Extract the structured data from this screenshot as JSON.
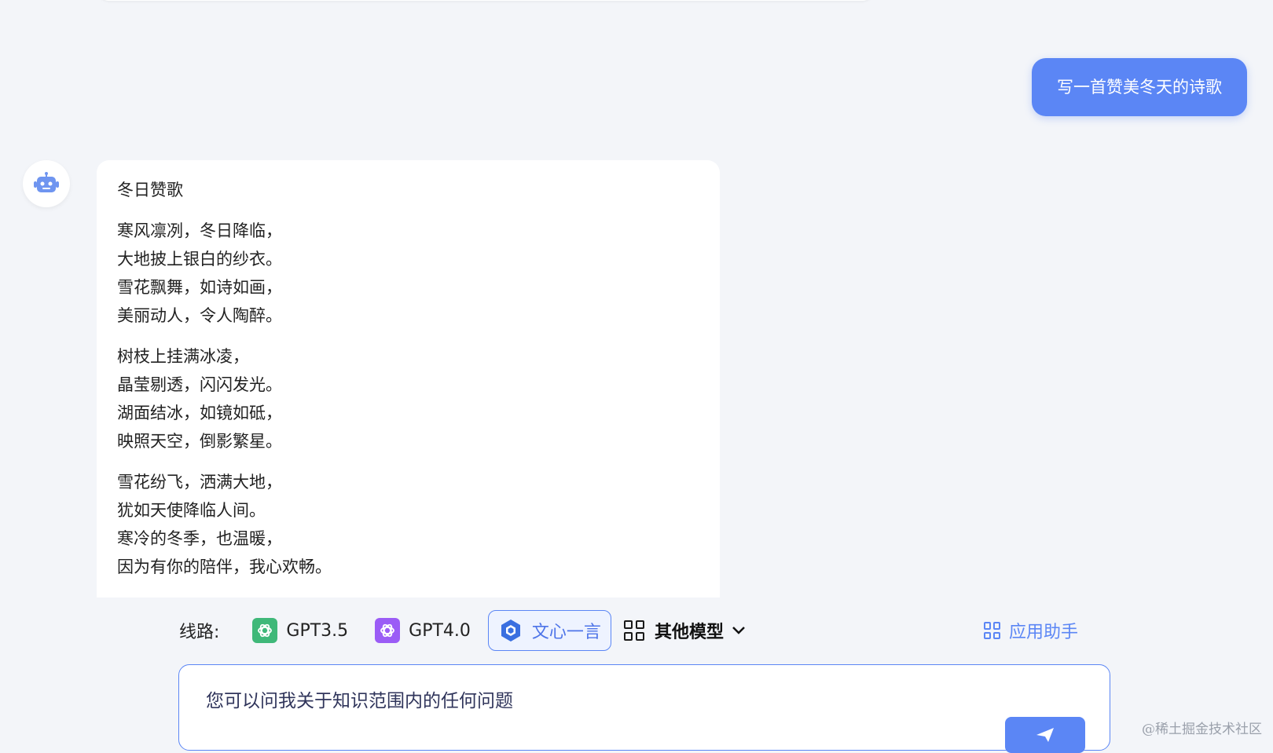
{
  "conversation": {
    "user_message": "写一首赞美冬天的诗歌",
    "bot_reply": {
      "title": "冬日赞歌",
      "stanzas": [
        [
          "寒风凛冽，冬日降临，",
          "大地披上银白的纱衣。",
          "雪花飘舞，如诗如画，",
          "美丽动人，令人陶醉。"
        ],
        [
          "树枝上挂满冰凌，",
          "晶莹剔透，闪闪发光。",
          "湖面结冰，如镜如砥，",
          "映照天空，倒影繁星。"
        ],
        [
          "雪花纷飞，洒满大地，",
          "犹如天使降临人间。",
          "寒冷的冬季，也温暖，",
          "因为有你的陪伴，我心欢畅。"
        ]
      ]
    }
  },
  "model_bar": {
    "route_label": "线路:",
    "options": [
      {
        "label": "GPT3.5",
        "icon": "openai-icon",
        "active": false
      },
      {
        "label": "GPT4.0",
        "icon": "openai-icon",
        "active": false
      },
      {
        "label": "文心一言",
        "icon": "ernie-icon",
        "active": true
      }
    ],
    "other_models_label": "其他模型",
    "app_helper_label": "应用助手"
  },
  "input": {
    "placeholder": "您可以问我关于知识范围内的任何问题"
  },
  "watermark": "@稀土掘金技术社区",
  "colors": {
    "accent": "#5b86f5",
    "background": "#f3f5f9",
    "gpt35": "#3fb879",
    "gpt40": "#9b5cf6"
  }
}
